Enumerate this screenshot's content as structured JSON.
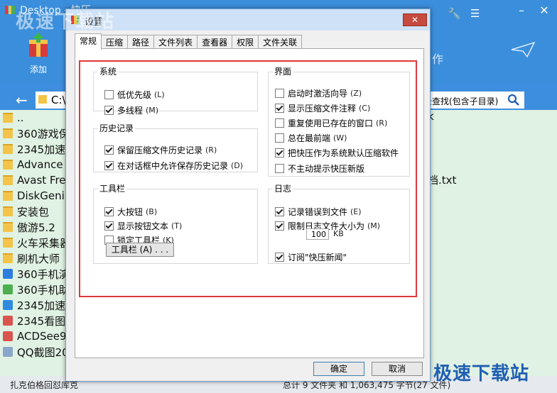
{
  "app": {
    "title": "Desktop - 快压",
    "add_label": "添加",
    "address": "C:\\",
    "search_label": "录查找(包含子目录)",
    "deco_text": "作"
  },
  "file_list": [
    {
      "name": "..",
      "icon": "folder-icon"
    },
    {
      "name": "360游戏保",
      "icon": "folder-icon"
    },
    {
      "name": "2345加速",
      "icon": "folder-icon"
    },
    {
      "name": "Advance",
      "icon": "folder-icon"
    },
    {
      "name": "Avast Fre",
      "icon": "folder-icon"
    },
    {
      "name": "DiskGeniu",
      "icon": "folder-icon"
    },
    {
      "name": "安装包",
      "icon": "folder-icon"
    },
    {
      "name": "傲游5.2",
      "icon": "folder-icon"
    },
    {
      "name": "火车采集器",
      "icon": "folder-icon"
    },
    {
      "name": "刷机大师",
      "icon": "folder-icon"
    },
    {
      "name": "360手机演",
      "icon": "phone-app-icon"
    },
    {
      "name": "360手机助",
      "icon": "app-icon"
    },
    {
      "name": "2345加速",
      "icon": "browser-icon"
    },
    {
      "name": "2345看图",
      "icon": "image-app-icon"
    },
    {
      "name": "ACDSee9.",
      "icon": "image-app-icon"
    },
    {
      "name": "QQ截图20",
      "icon": "image-file-icon"
    }
  ],
  "right_pane": {
    "item1": "k",
    "item2": "档.txt"
  },
  "status": {
    "left": "扎克伯格回怼库克",
    "right": "总计 9 文件夹 和 1,063,475 字节(27 文件)"
  },
  "watermarks": {
    "top": "极速下载站",
    "bottom": "极速下载站"
  },
  "dialog": {
    "title": "设置",
    "close_label": "✕",
    "tabs": [
      "常规",
      "压缩",
      "路径",
      "文件列表",
      "查看器",
      "权限",
      "文件关联"
    ],
    "active_tab": "常规",
    "groups": {
      "system": {
        "title": "系统",
        "options": [
          {
            "label": "低优先级",
            "shortcut": "(L)",
            "checked": false
          },
          {
            "label": "多线程",
            "shortcut": "(M)",
            "checked": true
          }
        ]
      },
      "history": {
        "title": "历史记录",
        "options": [
          {
            "label": "保留压缩文件历史记录",
            "shortcut": "(R)",
            "checked": true
          },
          {
            "label": "在对话框中允许保存历史记录",
            "shortcut": "(D)",
            "checked": true
          }
        ]
      },
      "toolbar": {
        "title": "工具栏",
        "options": [
          {
            "label": "大按钮",
            "shortcut": "(B)",
            "checked": true
          },
          {
            "label": "显示按钮文本",
            "shortcut": "(T)",
            "checked": true
          },
          {
            "label": "锁定工具栏",
            "shortcut": "(K)",
            "checked": false
          }
        ],
        "button_label": "工具栏 (A) . . ."
      },
      "interface": {
        "title": "界面",
        "options": [
          {
            "label": "启动时激活向导",
            "shortcut": "(Z)",
            "checked": false
          },
          {
            "label": "显示压缩文件注释",
            "shortcut": "(C)",
            "checked": true
          },
          {
            "label": "重复使用已存在的窗口",
            "shortcut": "(R)",
            "checked": false
          },
          {
            "label": "总在最前端",
            "shortcut": "(W)",
            "checked": false
          },
          {
            "label": "把快压作为系统默认压缩软件",
            "shortcut": "",
            "checked": true
          },
          {
            "label": "不主动提示快压新版",
            "shortcut": "",
            "checked": false
          }
        ]
      },
      "log": {
        "title": "日志",
        "options": [
          {
            "label": "记录错误到文件",
            "shortcut": "(E)",
            "checked": true
          },
          {
            "label": "限制日志文件大小为",
            "shortcut": "(M)",
            "checked": true
          },
          {
            "label": "订阅\"快压新闻\"",
            "shortcut": "",
            "checked": true
          }
        ],
        "size_value": "100",
        "size_unit": "KB"
      }
    },
    "ok_label": "确定",
    "cancel_label": "取消"
  },
  "colors": {
    "highlight": "#e0373d",
    "app_blue": "#3b8edb",
    "list_bg": "#e0f2e3"
  }
}
